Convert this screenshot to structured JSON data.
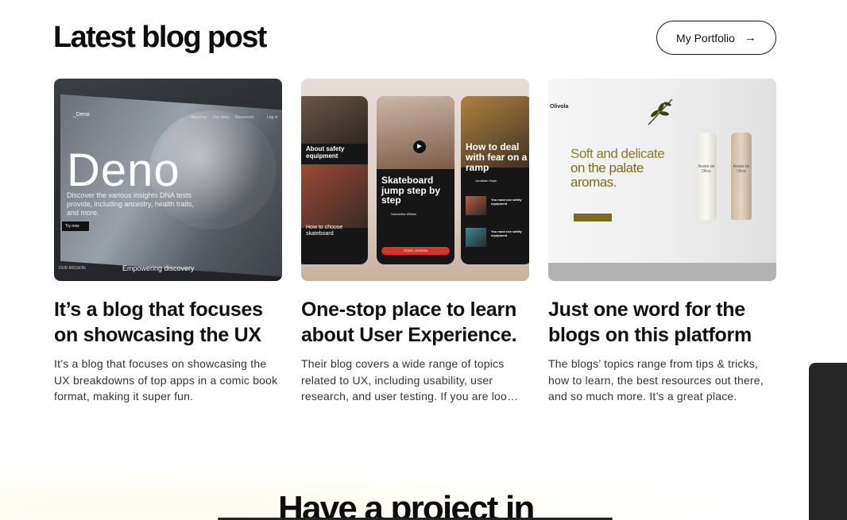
{
  "section": {
    "title": "Latest blog post",
    "portfolio_button": {
      "label": "My Portfolio",
      "icon": "arrow-right-icon"
    }
  },
  "posts": [
    {
      "title": "It’s a blog that focuses on showcasing the UX",
      "excerpt": "It’s a blog that focuses on showcasing the UX breakdowns of top apps in a comic book format, making it super fun.",
      "thumb": {
        "brand": "_Deno",
        "nav": [
          "About us",
          "Our story",
          "Resources",
          "Log in"
        ],
        "word": "Deno",
        "blurb": "Discover the various insights DNA tests provide, including ancestry, health traits, and more.",
        "cta": "Try now",
        "mission": "OUR MISSION",
        "footer": "Empowering discovery"
      }
    },
    {
      "title": "One-stop place to learn about User Experience.",
      "excerpt": "Their blog covers a wide range of topics related to UX, including usability, user research, and user testing. If you are loo…",
      "thumb": {
        "phone1_title": "About safety equipment",
        "phone1_footer": "How to choose skateboard",
        "phone2_title": "Skateboard jump step by step",
        "phone2_author": "Samantha William",
        "phone2_cta": "START LESSON",
        "phone3_title": "How to deal with fear on a ramp",
        "phone3_author": "Jonathan Hope",
        "phone3_item": "You must use safety equipment"
      }
    },
    {
      "title": "Just one word for the blogs on this platform",
      "excerpt": "The blogs’ topics range from tips & tricks, how to learn, the best resources out there, and so much more. It’s a great place.",
      "thumb": {
        "logo": "Olivola",
        "headline_1": "Soft and delicate",
        "headline_2": "on the palate",
        "headline_3": "aromas.",
        "bottle_label": "Aceite de Oliva"
      }
    }
  ],
  "next_section": {
    "heading": "Have a project in"
  },
  "colors": {
    "olive": "#7a6d20",
    "skate_red": "#d8322f",
    "dark_panel": "#262626"
  }
}
